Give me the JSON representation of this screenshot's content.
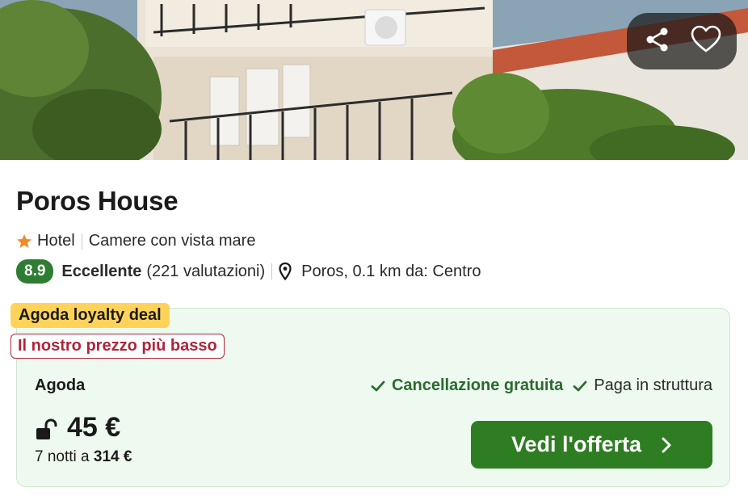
{
  "hotel": {
    "name": "Poros House",
    "type": "Hotel",
    "feature": "Camere con vista mare",
    "score": "8.9",
    "rating_word": "Eccellente",
    "reviews": "(221 valutazioni)",
    "location": "Poros, 0.1 km da: Centro"
  },
  "photo_actions": {
    "share_icon": "share-icon",
    "favorite_icon": "heart-icon"
  },
  "deal": {
    "loyalty_badge": "Agoda loyalty deal",
    "lowest_badge": "Il nostro prezzo più basso",
    "provider": "Agoda",
    "feature_1": "Cancellazione gratuita",
    "feature_2": "Paga in struttura",
    "price": "45 €",
    "total_prefix": "7 notti a",
    "total_value": "314 €",
    "cta_label": "Vedi l'offerta"
  },
  "colors": {
    "score_green": "#2e7d32",
    "cta_green": "#2e7d22",
    "deal_bg": "#eefaef",
    "loyalty_yellow": "#ffd359",
    "lowest_red": "#b0243b",
    "star_orange": "#f08a24"
  }
}
